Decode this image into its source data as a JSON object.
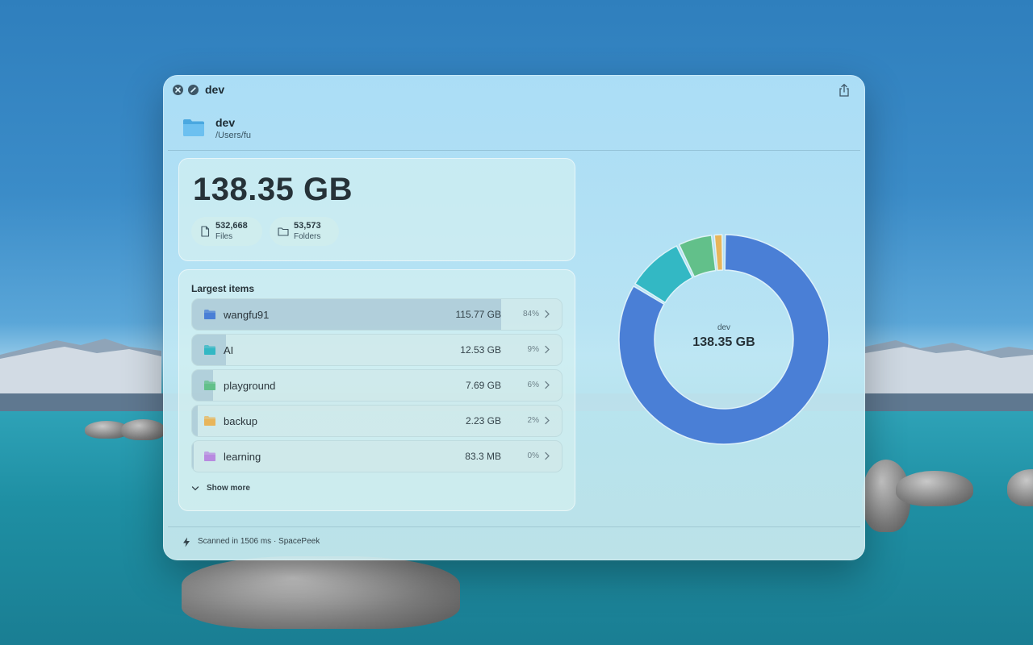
{
  "window": {
    "title": "dev"
  },
  "header": {
    "name": "dev",
    "path": "/Users/fu"
  },
  "summary": {
    "total_size": "138.35 GB",
    "files_count": "532,668",
    "files_label": "Files",
    "folders_count": "53,573",
    "folders_label": "Folders"
  },
  "largest": {
    "title": "Largest items",
    "show_more_label": "Show more",
    "items": [
      {
        "name": "wangfu91",
        "size": "115.77 GB",
        "pct_label": "84%",
        "fraction": 0.837,
        "color": "#4a7fd6"
      },
      {
        "name": "AI",
        "size": "12.53 GB",
        "pct_label": "9%",
        "fraction": 0.091,
        "color": "#33b8c4"
      },
      {
        "name": "playground",
        "size": "7.69 GB",
        "pct_label": "6%",
        "fraction": 0.056,
        "color": "#62c08a"
      },
      {
        "name": "backup",
        "size": "2.23 GB",
        "pct_label": "2%",
        "fraction": 0.016,
        "color": "#e8b55a"
      },
      {
        "name": "learning",
        "size": "83.3 MB",
        "pct_label": "0%",
        "fraction": 0.0006,
        "color": "#b88ae0"
      }
    ]
  },
  "chart_data": {
    "type": "pie",
    "center_name": "dev",
    "center_value": "138.35 GB",
    "categories": [
      "wangfu91",
      "AI",
      "playground",
      "backup",
      "learning"
    ],
    "values": [
      115.77,
      12.53,
      7.69,
      2.23,
      0.0833
    ],
    "colors": [
      "#4a7fd6",
      "#33b8c4",
      "#62c08a",
      "#e8b55a",
      "#b88ae0"
    ]
  },
  "footer": {
    "text": "Scanned in 1506 ms · SpacePeek"
  },
  "icons": {
    "close": "close-icon",
    "info": "info-icon",
    "share": "share-icon",
    "folder": "folder-icon",
    "file": "file-icon",
    "chevron": "chevron-right-icon",
    "bolt": "bolt-icon"
  }
}
